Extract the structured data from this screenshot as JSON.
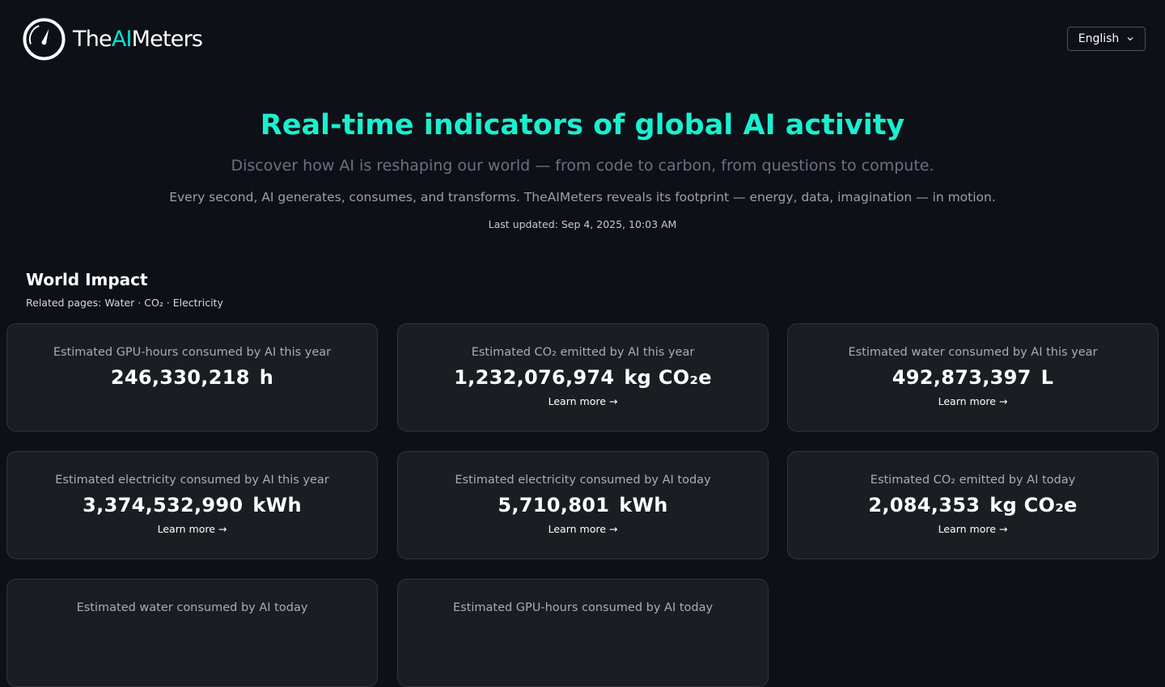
{
  "header": {
    "logo_prefix": "The",
    "logo_ai": "AI",
    "logo_suffix": "Meters",
    "language": "English"
  },
  "hero": {
    "title": "Real-time indicators of global AI activity",
    "subtitle": "Discover how AI is reshaping our world — from code to carbon, from questions to compute.",
    "description": "Every second, AI generates, consumes, and transforms. TheAIMeters reveals its footprint — energy, data, imagination — in motion.",
    "last_updated": "Last updated: Sep 4, 2025, 10:03 AM"
  },
  "section": {
    "title": "World Impact",
    "related_prefix": "Related pages: ",
    "related_links": [
      "Water",
      "CO₂",
      "Electricity"
    ],
    "separator": " · "
  },
  "cards": [
    {
      "label": "Estimated GPU-hours consumed by AI this year",
      "value": "246,330,218",
      "unit": "h",
      "link": ""
    },
    {
      "label": "Estimated CO₂ emitted by AI this year",
      "value": "1,232,076,974",
      "unit": "kg CO₂e",
      "link": "Learn more →"
    },
    {
      "label": "Estimated water consumed by AI this year",
      "value": "492,873,397",
      "unit": "L",
      "link": "Learn more →"
    },
    {
      "label": "Estimated electricity consumed by AI this year",
      "value": "3,374,532,990",
      "unit": "kWh",
      "link": "Learn more →"
    },
    {
      "label": "Estimated electricity consumed by AI today",
      "value": "5,710,801",
      "unit": "kWh",
      "link": "Learn more →"
    },
    {
      "label": "Estimated CO₂ emitted by AI today",
      "value": "2,084,353",
      "unit": "kg CO₂e",
      "link": "Learn more →"
    },
    {
      "label": "Estimated water consumed by AI today",
      "value": "",
      "unit": "",
      "link": ""
    },
    {
      "label": "Estimated GPU-hours consumed by AI today",
      "value": "",
      "unit": "",
      "link": ""
    }
  ]
}
